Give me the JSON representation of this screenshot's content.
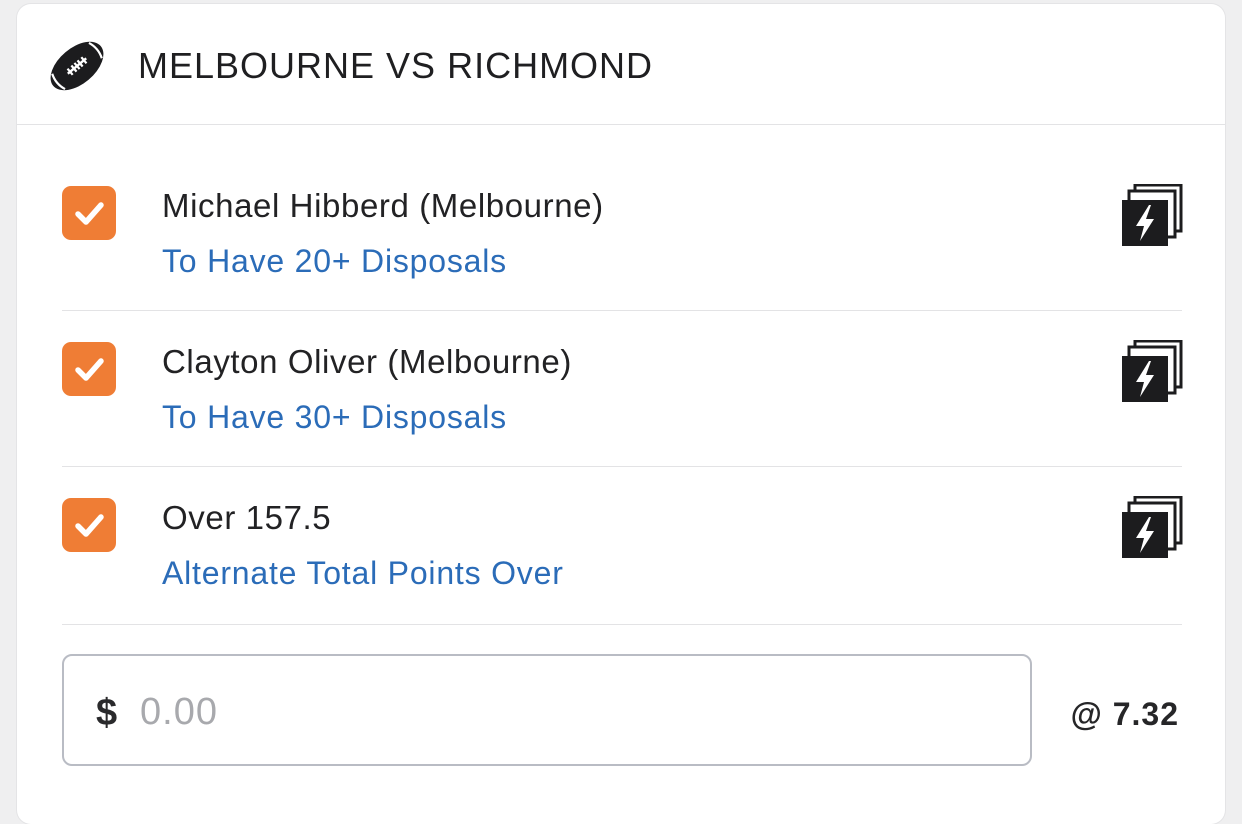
{
  "header": {
    "icon": "football-icon",
    "title": "MELBOURNE VS RICHMOND"
  },
  "legs": [
    {
      "selection": "Michael Hibberd (Melbourne)",
      "market": "To Have 20+ Disposals",
      "checked": true,
      "icon": "same-game-multi-icon"
    },
    {
      "selection": "Clayton Oliver (Melbourne)",
      "market": "To Have 30+ Disposals",
      "checked": true,
      "icon": "same-game-multi-icon"
    },
    {
      "selection": "Over 157.5",
      "market": "Alternate Total Points Over",
      "checked": true,
      "icon": "same-game-multi-icon"
    }
  ],
  "stake": {
    "currency": "$",
    "value": "",
    "placeholder": "0.00",
    "odds": "@ 7.32"
  },
  "colors": {
    "accent": "#ef7d35",
    "link": "#2b6cb8",
    "background": "#efeff0",
    "card": "#ffffff"
  }
}
